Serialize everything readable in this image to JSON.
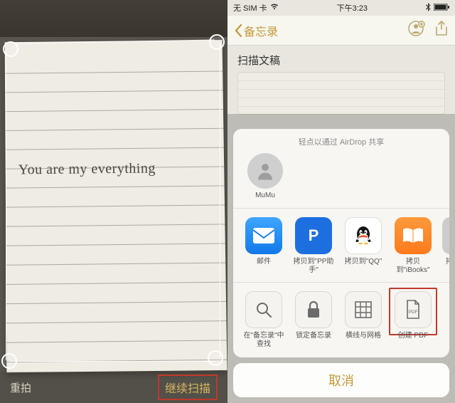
{
  "scan": {
    "handwriting_text": "You are my everything",
    "retake_label": "重拍",
    "continue_label": "继续扫描"
  },
  "status_bar": {
    "carrier": "无 SIM 卡",
    "time": "下午3:23"
  },
  "nav": {
    "back_label": "备忘录"
  },
  "note": {
    "title": "扫描文稿"
  },
  "share_sheet": {
    "airdrop_hint": "轻点以通过 AirDrop 共享",
    "contact_name": "MuMu",
    "apps": [
      {
        "label": "邮件"
      },
      {
        "label": "拷贝到\"PP助手\""
      },
      {
        "label": "拷贝到\"QQ\""
      },
      {
        "label": "拷贝到\"iBooks\""
      },
      {
        "label": "拷"
      }
    ],
    "actions": [
      {
        "label": "在\"备忘录\"中查找"
      },
      {
        "label": "锁定备忘录"
      },
      {
        "label": "横线与网格"
      },
      {
        "label": "创建 PDF"
      }
    ],
    "cancel_label": "取消"
  }
}
